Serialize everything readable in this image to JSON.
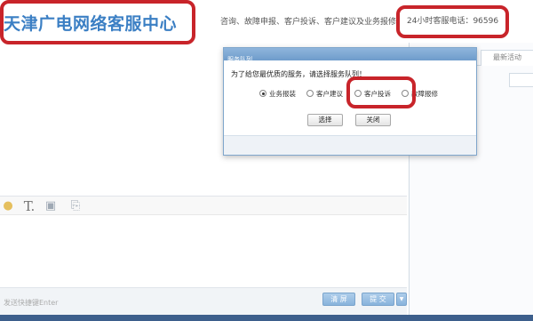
{
  "header": {
    "site_title": "天津广电网络客服中心",
    "nav_text": "咨询、故障申报、客户投诉、客户建议及业务报修",
    "hotline": "24小时客服电话：96596"
  },
  "right_panel": {
    "tabs": [
      "",
      "最新活动"
    ]
  },
  "toolbar": {
    "icons": [
      "emoji-icon",
      "font-icon",
      "save-icon",
      "attachment-icon"
    ]
  },
  "footer": {
    "shortcut_hint": "发送快捷键Enter",
    "clear_label": "清 屏",
    "send_label": "提 交",
    "send_menu_arrow": "▼"
  },
  "dialog": {
    "title": "服务队列",
    "prompt": "为了给您最优质的服务，请选择服务队列！",
    "options": [
      "业务报装",
      "客户建议",
      "客户投诉",
      "故障报修"
    ],
    "selected_option": "业务报装",
    "select_label": "选择",
    "close_label": "关闭"
  },
  "colors": {
    "highlight": "#c8242a",
    "brand": "#3b7fc4",
    "bottom_strip": "#3d5f8c"
  }
}
